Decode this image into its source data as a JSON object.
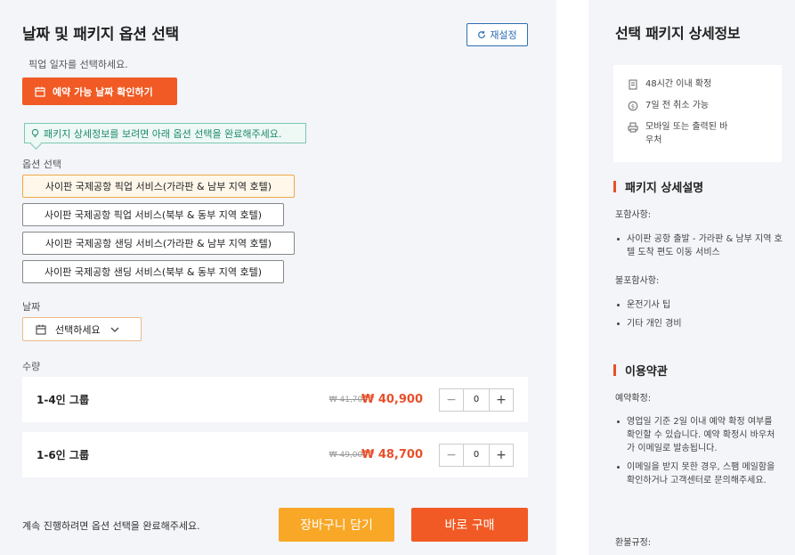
{
  "left": {
    "title": "날짜 및 패키지 옵션 선택",
    "reset_label": "재설정",
    "pickup_hint": "픽업 일자를 선택하세요.",
    "check_dates_label": "예약 가능 날짜 확인하기",
    "info_tip": "패키지 상세정보를 보려면 아래 옵션 선택을 완료해주세요.",
    "options_label": "옵션 선택",
    "options": [
      "사이판 국제공항 픽업 서비스(가라판 & 남부 지역 호텔)",
      "사이판 국제공항 픽업 서비스(북부 & 동부 지역 호텔)",
      "사이판 국제공항 샌딩 서비스(가라판 & 남부 지역 호텔)",
      "사이판 국제공항 샌딩 서비스(북부 & 동부 지역 호텔)"
    ],
    "date_label": "날짜",
    "date_placeholder": "선택하세요",
    "qty_label": "수량",
    "qty_rows": [
      {
        "name": "1-4인 그룹",
        "old_price": "₩ 41,700",
        "new_price": "₩ 40,900",
        "qty": "0"
      },
      {
        "name": "1-6인 그룹",
        "old_price": "₩ 49,000",
        "new_price": "₩ 48,700",
        "qty": "0"
      }
    ],
    "bottom_note": "계속 진행하려면 옵션 선택을 완료해주세요.",
    "cart_label": "장바구니 담기",
    "buy_label": "바로 구매"
  },
  "right": {
    "title": "선택 패키지 상세정보",
    "features": [
      {
        "icon": "document-icon",
        "text": "48시간 이내 확정"
      },
      {
        "icon": "refund-icon",
        "text": "7일 전 취소 가능"
      },
      {
        "icon": "printer-icon",
        "text": "모바일 또는 출력된 바우처"
      }
    ],
    "desc_heading": "패키지 상세설명",
    "included_label": "포함사항:",
    "included": [
      "사이판 공항 출발 - 가라판 & 남부 지역 호텔 도착 편도 이동 서비스"
    ],
    "excluded_label": "불포함사항:",
    "excluded": [
      "운전기사 팁",
      "기타 개인 경비"
    ],
    "terms_heading": "이용약관",
    "confirm_label": "예약확정:",
    "confirm_items": [
      "영업일 기준 2일 이내 예약 확정 여부를 확인할 수 있습니다. 예약 확정시 바우처가 이메일로 발송됩니다.",
      "이메일을 받지 못한 경우, 스팸 메일함을 확인하거나 고객센터로 문의해주세요."
    ],
    "refund_label": "환불규정:"
  },
  "colors": {
    "accent": "#f15a24",
    "cart": "#f9a727",
    "link": "#2f6fb3",
    "tip": "#1d8a6d"
  }
}
